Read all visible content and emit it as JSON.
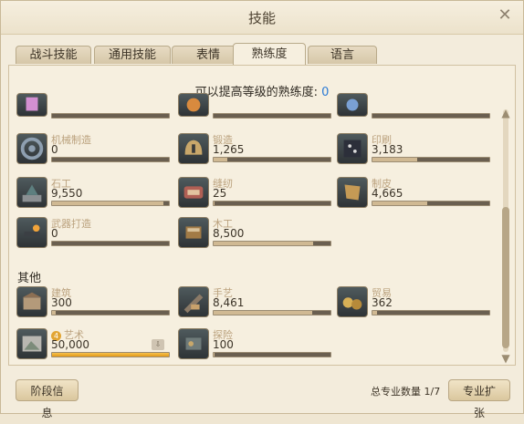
{
  "window": {
    "title": "技能"
  },
  "tabs": [
    {
      "label": "战斗技能"
    },
    {
      "label": "通用技能"
    },
    {
      "label": "表情"
    },
    {
      "label": "熟练度"
    },
    {
      "label": "语言"
    }
  ],
  "proficiency": {
    "label": "可以提高等级的熟练度:",
    "value": "0"
  },
  "crafting_items": [
    {
      "name": "机械制造",
      "value": "0",
      "fill": 0.0
    },
    {
      "name": "锻造",
      "value": "1,265",
      "fill": 0.12
    },
    {
      "name": "印刷",
      "value": "3,183",
      "fill": 0.38
    },
    {
      "name": "石工",
      "value": "9,550",
      "fill": 0.95
    },
    {
      "name": "缝纫",
      "value": "25",
      "fill": 0.01
    },
    {
      "name": "制皮",
      "value": "4,665",
      "fill": 0.47
    },
    {
      "name": "武器打造",
      "value": "0",
      "fill": 0.0
    },
    {
      "name": "木工",
      "value": "8,500",
      "fill": 0.85
    }
  ],
  "other_section": {
    "title": "其他"
  },
  "other_items": [
    {
      "name": "建筑",
      "value": "300",
      "fill": 0.03
    },
    {
      "name": "手艺",
      "value": "8,461",
      "fill": 0.84
    },
    {
      "name": "贸易",
      "value": "362",
      "fill": 0.04
    },
    {
      "name": "艺术",
      "value": "50,000",
      "fill": 1.0,
      "badge": "4"
    },
    {
      "name": "探险",
      "value": "100",
      "fill": 0.01
    }
  ],
  "footer": {
    "info_button": "阶段信息",
    "count_label": "总专业数量 1/7",
    "expand_button": "专业扩张"
  },
  "icons": {
    "close": "close-icon",
    "scroll_up": "chevron-up-icon",
    "scroll_down": "chevron-down-icon",
    "download": "download-icon"
  },
  "colors": {
    "accent_blue": "#2b7ad5",
    "bar_fill": "#d0b993",
    "bar_fill_orange": "#e39a18",
    "label_color": "#bba27e"
  }
}
